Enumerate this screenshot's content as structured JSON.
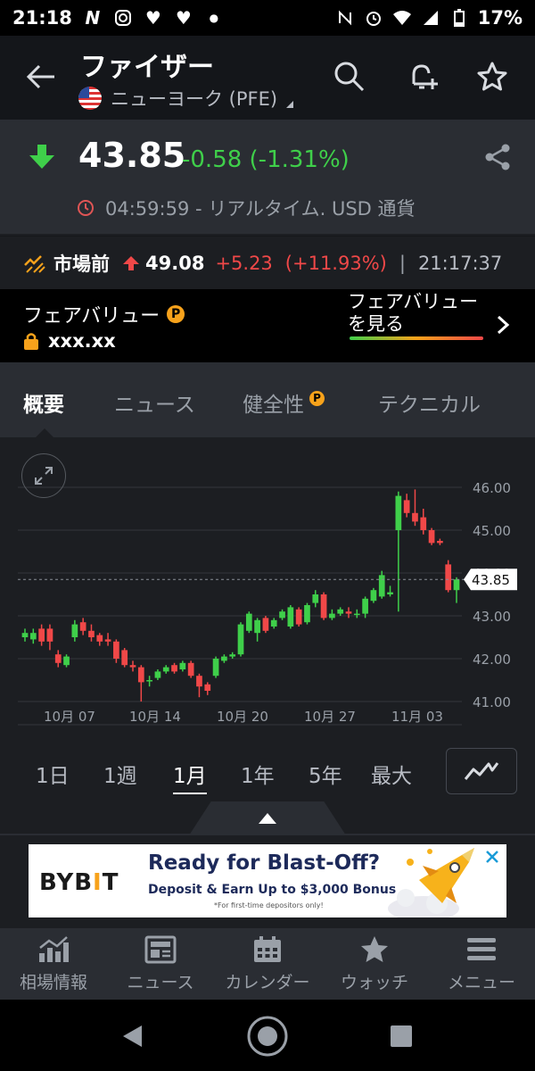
{
  "status_bar": {
    "time": "21:18",
    "battery": "17%",
    "icons": [
      "n-app-icon",
      "instagram-icon",
      "heart-icon",
      "heart-icon",
      "dot-icon",
      "nfc-icon",
      "alarm-icon",
      "wifi-icon",
      "signal-icon",
      "battery-icon"
    ]
  },
  "header": {
    "title": "ファイザー",
    "subtitle": "ニューヨーク (PFE)"
  },
  "quote": {
    "price": "43.85",
    "change": "-0.58 (-1.31%)",
    "time_text": "04:59:59 - リアルタイム. USD 通貨",
    "change_color": "#3fcf4a"
  },
  "pre_market": {
    "label": "市場前",
    "price": "49.08",
    "change": "+5.23",
    "change_pct": "(+11.93%)",
    "separator": "|",
    "time": "21:17:37",
    "change_color": "#f04848"
  },
  "fair_value": {
    "title": "フェアバリュー",
    "locked_value": "xxx.xx",
    "see_label_line1": "フェアバリュー",
    "see_label_line2": "を見る"
  },
  "tabs": [
    {
      "label": "概要",
      "active": true
    },
    {
      "label": "ニュース",
      "active": false
    },
    {
      "label": "健全性",
      "active": false,
      "pro": true
    },
    {
      "label": "テクニカル",
      "active": false
    }
  ],
  "chart_data": {
    "type": "candlestick",
    "y_ticks": [
      "46.00",
      "45.00",
      "44.00",
      "43.00",
      "42.00",
      "41.00"
    ],
    "ylim": [
      41.0,
      46.0
    ],
    "x_ticks": [
      "10月 07",
      "10月 14",
      "10月 20",
      "10月 27",
      "11月 03"
    ],
    "last_price_label": "43.85",
    "last_price": 43.85,
    "grid": true,
    "up_color": "#3fcf4a",
    "down_color": "#f04848",
    "candles": [
      {
        "open": 42.5,
        "close": 42.6,
        "high": 42.7,
        "low": 42.4
      },
      {
        "open": 42.45,
        "close": 42.6,
        "high": 42.7,
        "low": 42.35
      },
      {
        "open": 42.7,
        "close": 42.4,
        "high": 42.8,
        "low": 42.3
      },
      {
        "open": 42.7,
        "close": 42.4,
        "high": 42.8,
        "low": 42.2
      },
      {
        "open": 42.1,
        "close": 41.9,
        "high": 42.2,
        "low": 41.8
      },
      {
        "open": 41.85,
        "close": 42.05,
        "high": 42.1,
        "low": 41.8
      },
      {
        "open": 42.5,
        "close": 42.8,
        "high": 42.9,
        "low": 42.4
      },
      {
        "open": 42.85,
        "close": 42.65,
        "high": 42.95,
        "low": 42.55
      },
      {
        "open": 42.65,
        "close": 42.5,
        "high": 42.8,
        "low": 42.4
      },
      {
        "open": 42.55,
        "close": 42.4,
        "high": 42.6,
        "low": 42.3
      },
      {
        "open": 42.45,
        "close": 42.4,
        "high": 42.6,
        "low": 42.3
      },
      {
        "open": 42.4,
        "close": 42.0,
        "high": 42.45,
        "low": 41.9
      },
      {
        "open": 42.2,
        "close": 41.85,
        "high": 42.25,
        "low": 41.8
      },
      {
        "open": 41.85,
        "close": 41.8,
        "high": 41.95,
        "low": 41.7
      },
      {
        "open": 41.8,
        "close": 41.45,
        "high": 41.85,
        "low": 41.0
      },
      {
        "open": 41.5,
        "close": 41.5,
        "high": 41.6,
        "low": 41.35
      },
      {
        "open": 41.55,
        "close": 41.7,
        "high": 41.75,
        "low": 41.5
      },
      {
        "open": 41.7,
        "close": 41.8,
        "high": 41.85,
        "low": 41.65
      },
      {
        "open": 41.85,
        "close": 41.7,
        "high": 41.9,
        "low": 41.65
      },
      {
        "open": 41.75,
        "close": 41.9,
        "high": 41.95,
        "low": 41.7
      },
      {
        "open": 41.9,
        "close": 41.6,
        "high": 41.95,
        "low": 41.55
      },
      {
        "open": 41.6,
        "close": 41.35,
        "high": 41.65,
        "low": 41.1
      },
      {
        "open": 41.4,
        "close": 41.25,
        "high": 41.45,
        "low": 41.15
      },
      {
        "open": 41.6,
        "close": 42.0,
        "high": 42.05,
        "low": 41.55
      },
      {
        "open": 41.95,
        "close": 42.05,
        "high": 42.1,
        "low": 41.9
      },
      {
        "open": 42.05,
        "close": 42.1,
        "high": 42.15,
        "low": 42.0
      },
      {
        "open": 42.1,
        "close": 42.8,
        "high": 42.85,
        "low": 42.05
      },
      {
        "open": 42.65,
        "close": 43.05,
        "high": 43.1,
        "low": 42.6
      },
      {
        "open": 42.6,
        "close": 42.9,
        "high": 42.95,
        "low": 42.4
      },
      {
        "open": 42.95,
        "close": 42.65,
        "high": 43.0,
        "low": 42.6
      },
      {
        "open": 42.75,
        "close": 42.9,
        "high": 42.95,
        "low": 42.7
      },
      {
        "open": 42.95,
        "close": 43.1,
        "high": 43.15,
        "low": 42.9
      },
      {
        "open": 42.75,
        "close": 43.2,
        "high": 43.25,
        "low": 42.7
      },
      {
        "open": 43.15,
        "close": 42.8,
        "high": 43.2,
        "low": 42.75
      },
      {
        "open": 42.85,
        "close": 43.25,
        "high": 43.3,
        "low": 42.8
      },
      {
        "open": 43.3,
        "close": 43.5,
        "high": 43.6,
        "low": 43.2
      },
      {
        "open": 43.5,
        "close": 42.95,
        "high": 43.55,
        "low": 42.9
      },
      {
        "open": 42.95,
        "close": 43.05,
        "high": 43.15,
        "low": 42.9
      },
      {
        "open": 43.05,
        "close": 43.15,
        "high": 43.2,
        "low": 43.0
      },
      {
        "open": 43.1,
        "close": 43.05,
        "high": 43.2,
        "low": 42.95
      },
      {
        "open": 43.05,
        "close": 43.05,
        "high": 43.15,
        "low": 42.95
      },
      {
        "open": 43.05,
        "close": 43.4,
        "high": 43.45,
        "low": 42.95
      },
      {
        "open": 43.35,
        "close": 43.6,
        "high": 43.65,
        "low": 43.3
      },
      {
        "open": 43.45,
        "close": 43.95,
        "high": 44.05,
        "low": 43.4
      },
      {
        "open": 43.5,
        "close": 43.55,
        "high": 43.7,
        "low": 43.45
      },
      {
        "open": 45.0,
        "close": 45.8,
        "high": 45.9,
        "low": 43.1
      },
      {
        "open": 45.7,
        "close": 45.4,
        "high": 45.85,
        "low": 45.3
      },
      {
        "open": 45.4,
        "close": 45.2,
        "high": 45.95,
        "low": 45.1
      },
      {
        "open": 45.3,
        "close": 45.0,
        "high": 45.5,
        "low": 44.9
      },
      {
        "open": 45.0,
        "close": 44.7,
        "high": 45.05,
        "low": 44.65
      },
      {
        "open": 44.75,
        "close": 44.7,
        "high": 44.8,
        "low": 44.65
      },
      {
        "open": 44.2,
        "close": 43.6,
        "high": 44.3,
        "low": 43.55
      },
      {
        "open": 43.6,
        "close": 43.85,
        "high": 43.9,
        "low": 43.3
      }
    ]
  },
  "time_ranges": [
    {
      "label": "1日",
      "active": false
    },
    {
      "label": "1週",
      "active": false
    },
    {
      "label": "1月",
      "active": true
    },
    {
      "label": "1年",
      "active": false
    },
    {
      "label": "5年",
      "active": false
    },
    {
      "label": "最大",
      "active": false
    }
  ],
  "ad": {
    "logo_text_1": "BYB",
    "logo_text_2": "I",
    "logo_text_3": "T",
    "headline": "Ready for Blast-Off?",
    "subline": "Deposit & Earn Up to $3,000 Bonus",
    "fine_print": "*For first-time depositors only!"
  },
  "bottom_nav": [
    {
      "label": "相場情報",
      "icon": "chart-bars-icon"
    },
    {
      "label": "ニュース",
      "icon": "newspaper-icon"
    },
    {
      "label": "カレンダー",
      "icon": "calendar-icon"
    },
    {
      "label": "ウォッチ",
      "icon": "star-icon"
    },
    {
      "label": "メニュー",
      "icon": "menu-icon"
    }
  ]
}
